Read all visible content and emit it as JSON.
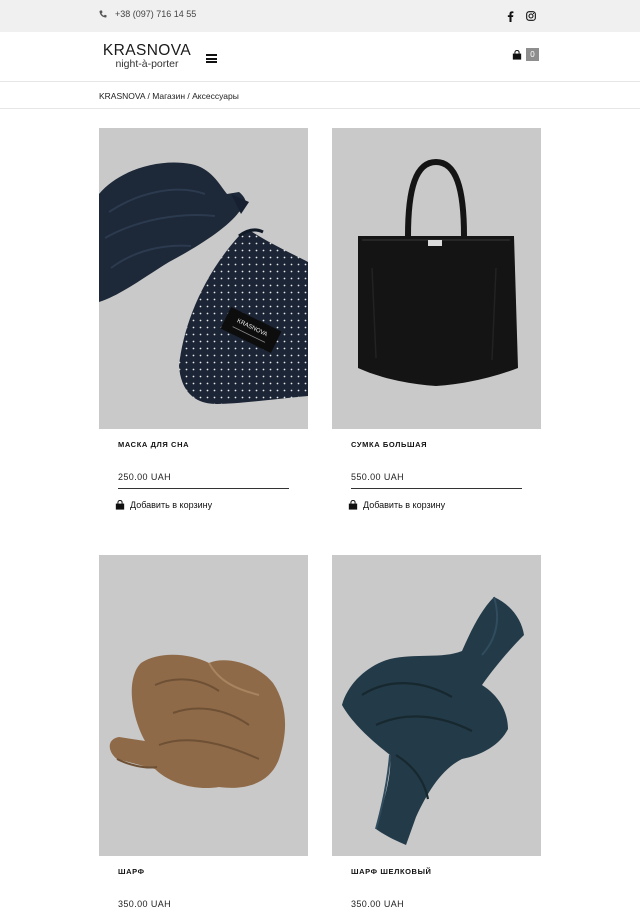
{
  "topbar": {
    "phone": "+38 (097) 716 14 55",
    "icons": [
      "phone-icon",
      "facebook-icon",
      "instagram-icon"
    ]
  },
  "header": {
    "logo_main": "KRASNOVA",
    "logo_sub": "night-à-porter",
    "cart_count": "0",
    "icons": [
      "menu-icon",
      "cart-icon"
    ]
  },
  "breadcrumbs": {
    "items": [
      "KRASNOVA",
      "Магазин",
      "Аксессуары"
    ],
    "separator": " / "
  },
  "products": [
    {
      "name": "МАСКА ДЛЯ СНА",
      "price": "250.00 UAH",
      "cta": "Добавить в корзину",
      "label_text": "KRASNOVA"
    },
    {
      "name": "СУМКА БОЛЬШАЯ",
      "price": "550.00 UAH",
      "cta": "Добавить в корзину"
    },
    {
      "name": "ШАРФ",
      "price": "350.00 UAH"
    },
    {
      "name": "ШАРФ ШЕЛКОВЫЙ",
      "price": "350.00 UAH"
    }
  ],
  "colors": {
    "topbar_bg": "#f0f0f0",
    "photo_bg": "#c9c9c9",
    "cart_badge": "#8e8e8e",
    "navy": "#1b2535",
    "tote_black": "#141414",
    "scarf_brown": "#8f6a48",
    "scarf_teal": "#233a48"
  }
}
